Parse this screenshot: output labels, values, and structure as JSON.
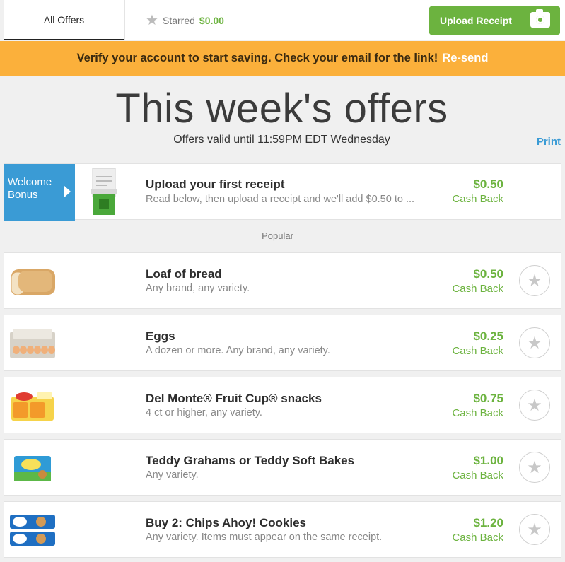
{
  "nav": {
    "all_offers": "All Offers",
    "starred_label": "Starred",
    "starred_amount": "$0.00",
    "upload_label": "Upload Receipt"
  },
  "banner": {
    "message": "Verify your account to start saving. Check your email for the link!",
    "resend": "Re-send"
  },
  "header": {
    "title": "This week's offers",
    "subtitle": "Offers valid until 11:59PM EDT Wednesday",
    "print": "Print"
  },
  "welcome": {
    "tag_line1": "Welcome",
    "tag_line2": "Bonus",
    "title": "Upload your first receipt",
    "desc": "Read below, then upload a receipt and we'll add $0.50 to ...",
    "price": "$0.50",
    "cashback": "Cash Back"
  },
  "section_label": "Popular",
  "offers": [
    {
      "title": "Loaf of bread",
      "desc": "Any brand, any variety.",
      "price": "$0.50",
      "cashback": "Cash Back",
      "icon": "bread"
    },
    {
      "title": "Eggs",
      "desc": "A dozen or more. Any brand, any variety.",
      "price": "$0.25",
      "cashback": "Cash Back",
      "icon": "eggs"
    },
    {
      "title": "Del Monte® Fruit Cup® snacks",
      "desc": "4 ct or higher, any variety.",
      "price": "$0.75",
      "cashback": "Cash Back",
      "icon": "fruit-cup"
    },
    {
      "title": "Teddy Grahams or Teddy Soft Bakes",
      "desc": "Any variety.",
      "price": "$1.00",
      "cashback": "Cash Back",
      "icon": "teddy-grahams"
    },
    {
      "title": "Buy 2: Chips Ahoy! Cookies",
      "desc": "Any variety. Items must appear on the same receipt.",
      "price": "$1.20",
      "cashback": "Cash Back",
      "icon": "chips-ahoy"
    }
  ],
  "colors": {
    "green": "#6cb33f",
    "orange": "#fbb03b",
    "blue": "#3a9bd5"
  }
}
